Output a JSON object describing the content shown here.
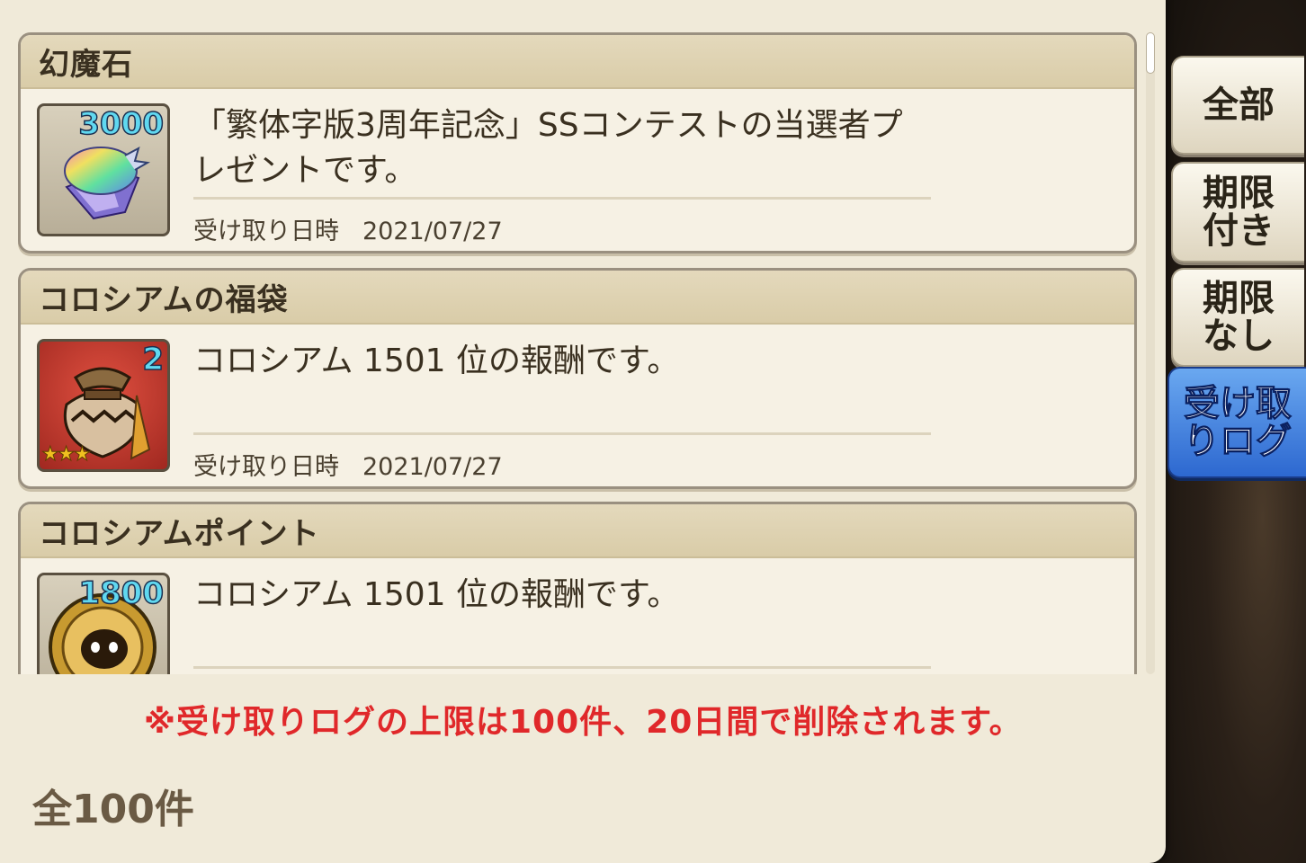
{
  "items": [
    {
      "title": "幻魔石",
      "count": "3000",
      "description": "「繁体字版3周年記念」SSコンテストの当選者プレゼントです。",
      "date_label": "受け取り日時",
      "date": "2021/07/27"
    },
    {
      "title": "コロシアムの福袋",
      "count": "2",
      "stars": "★★★",
      "description": "コロシアム 1501 位の報酬です。",
      "date_label": "受け取り日時",
      "date": "2021/07/27"
    },
    {
      "title": "コロシアムポイント",
      "count": "1800",
      "description": "コロシアム 1501 位の報酬です。",
      "date_label": "",
      "date": ""
    }
  ],
  "notice": "※受け取りログの上限は100件、20日間で削除されます。",
  "total": "全100件",
  "tabs": [
    {
      "label": "全部",
      "active": false
    },
    {
      "label": "期限付き",
      "active": false
    },
    {
      "label": "期限なし",
      "active": false
    },
    {
      "label": "受け取りログ",
      "active": true
    }
  ],
  "colors": {
    "panel": "#f0ead9",
    "notice": "#e0282a",
    "active_tab": "#2d68d0"
  }
}
